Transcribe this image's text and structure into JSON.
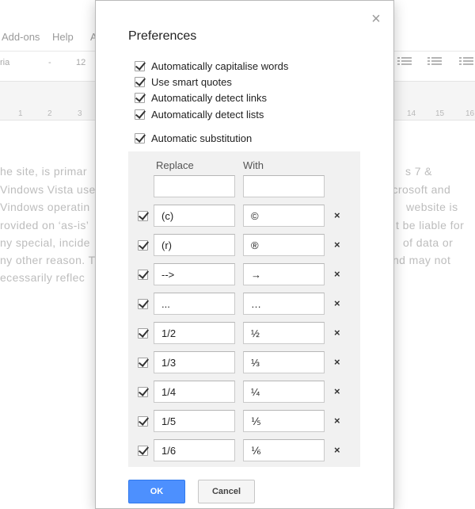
{
  "background": {
    "menu": [
      "Add-ons",
      "Help",
      "A"
    ],
    "toolbar": {
      "font": "ria",
      "dash": "-",
      "size": "12"
    },
    "ruler": [
      "1",
      "2",
      "3",
      "14",
      "15",
      "16"
    ],
    "doc_left": [
      "he site, is primar",
      "Vindows Vista use",
      "Vindows operatin",
      "rovided on ‘as-is’",
      "ny special, incide",
      "ny other reason. T",
      "ecessarily  reflec"
    ],
    "doc_right": [
      "s 7 &",
      "icrosoft and",
      "website is",
      "t be liable for",
      "of data or",
      "nd may not"
    ]
  },
  "dialog": {
    "title": "Preferences",
    "close_symbol": "×",
    "options": [
      {
        "label": "Automatically capitalise words",
        "checked": true
      },
      {
        "label": "Use smart quotes",
        "checked": true
      },
      {
        "label": "Automatically detect links",
        "checked": true
      },
      {
        "label": "Automatically detect lists",
        "checked": true
      }
    ],
    "substitution": {
      "label": "Automatic substitution",
      "checked": true
    },
    "table": {
      "col_replace": "Replace",
      "col_with": "With",
      "new_row": {
        "replace": "",
        "with": ""
      },
      "rows": [
        {
          "replace": "(c)",
          "with": "©",
          "checked": true
        },
        {
          "replace": "(r)",
          "with": "®",
          "checked": true
        },
        {
          "replace": "-->",
          "with": "→",
          "checked": true
        },
        {
          "replace": "...",
          "with": "…",
          "checked": true
        },
        {
          "replace": "1/2",
          "with": "½",
          "checked": true
        },
        {
          "replace": "1/3",
          "with": "⅓",
          "checked": true
        },
        {
          "replace": "1/4",
          "with": "¼",
          "checked": true
        },
        {
          "replace": "1/5",
          "with": "⅕",
          "checked": true
        },
        {
          "replace": "1/6",
          "with": "⅙",
          "checked": true
        }
      ],
      "delete_symbol": "×"
    },
    "ok_label": "OK",
    "cancel_label": "Cancel"
  }
}
